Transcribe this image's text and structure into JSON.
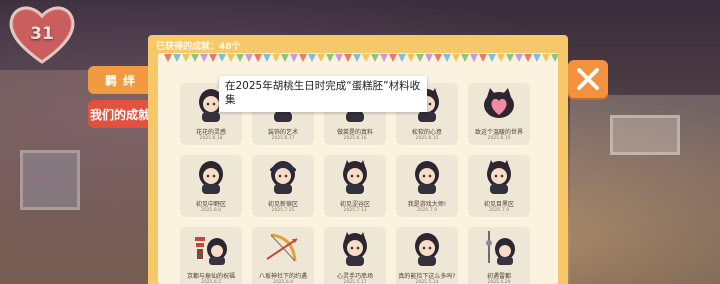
{
  "hud": {
    "heart_value": "31",
    "heart_color": "#c95a5a"
  },
  "tabs": [
    {
      "label": "羁绊",
      "active": false,
      "color": "#f19a3f"
    },
    {
      "label": "我们的成就",
      "active": true,
      "color": "#e2513e"
    }
  ],
  "panel": {
    "header": "已获得的成就：48个",
    "accent": "#f6c86a"
  },
  "tooltip": {
    "text": "在2025年胡桃生日时完成“蛋糕胚”材料收集"
  },
  "achievements": [
    {
      "title": "花花的灵感",
      "date": "2025.8.18",
      "icon": "girl-holding-paper-icon"
    },
    {
      "title": "装饰的艺术",
      "date": "2025.8.17",
      "icon": "cat-girl-icon"
    },
    {
      "title": "做菜是的真料",
      "date": "2025.8.16",
      "icon": "cat-girl-cooking-icon"
    },
    {
      "title": "松软的心意",
      "date": "2025.8.15",
      "icon": "cat-girl-cake-icon"
    },
    {
      "title": "致这个温暖的世界",
      "date": "2025.8.10",
      "icon": "cat-heart-icon"
    },
    {
      "title": "初见中野区",
      "date": "2025.8.8",
      "icon": "hooded-girl-icon"
    },
    {
      "title": "初见新宿区",
      "date": "2025.7.25",
      "icon": "police-girl-icon"
    },
    {
      "title": "初见涩谷区",
      "date": "2025.7.13",
      "icon": "cat-girl-sweater-icon"
    },
    {
      "title": "我是游戏大师!",
      "date": "2025.7.9",
      "icon": "girl-lying-icon"
    },
    {
      "title": "初见目黑区",
      "date": "2025.7.9",
      "icon": "cat-with-girl-icon"
    },
    {
      "title": "京都与振仙的祝福",
      "date": "2025.6.5",
      "icon": "pagoda-girl-icon"
    },
    {
      "title": "八坂神社下的约遇",
      "date": "2025.6.4",
      "icon": "bow-arrow-icon"
    },
    {
      "title": "心灵手巧串场",
      "date": "2025.5.17",
      "icon": "cat-girl-standing-icon"
    },
    {
      "title": "真的能捡下这么多吗?",
      "date": "2025.5.14",
      "icon": "girl-face-icon"
    },
    {
      "title": "初遇雷都",
      "date": "2025.4.29",
      "icon": "girl-tower-icon"
    }
  ],
  "close": {
    "label": "close"
  }
}
